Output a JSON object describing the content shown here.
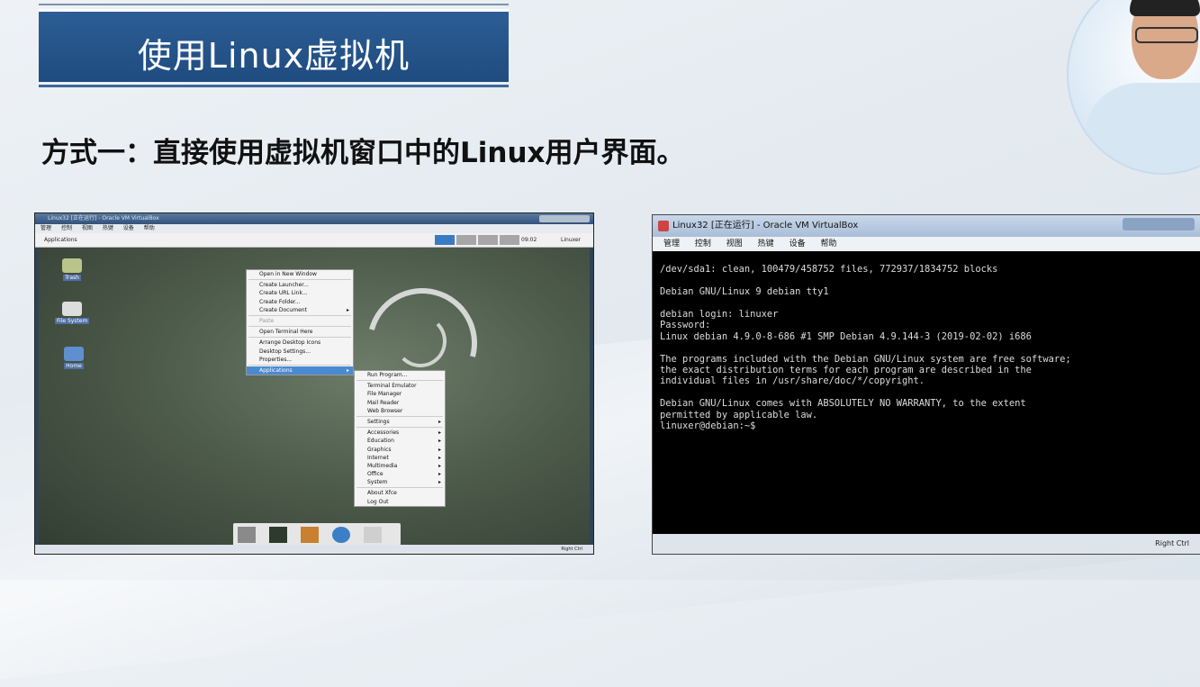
{
  "slide": {
    "title": "使用Linux虚拟机",
    "subtitle": "方式一：直接使用虚拟机窗口中的Linux用户界面。"
  },
  "left_window": {
    "title": "Linux32 [正在运行] - Oracle VM VirtualBox",
    "menu": [
      "管理",
      "控制",
      "视图",
      "热键",
      "设备",
      "帮助"
    ],
    "panel": {
      "applications": "Applications",
      "clock": "09:02",
      "user": "Linuxer"
    },
    "desktop_icons": [
      "Trash",
      "File System",
      "Home"
    ],
    "context_menu": [
      {
        "label": "Open in New Window",
        "arrow": ""
      },
      {
        "label": "Create Launcher...",
        "arrow": ""
      },
      {
        "label": "Create URL Link...",
        "arrow": ""
      },
      {
        "label": "Create Folder...",
        "arrow": ""
      },
      {
        "label": "Create Document",
        "arrow": "▸"
      },
      {
        "label": "Paste",
        "arrow": ""
      },
      {
        "label": "Open Terminal Here",
        "arrow": ""
      },
      {
        "label": "Arrange Desktop Icons",
        "arrow": ""
      },
      {
        "label": "Desktop Settings...",
        "arrow": ""
      },
      {
        "label": "Properties...",
        "arrow": ""
      },
      {
        "label": "Applications",
        "arrow": "▸"
      }
    ],
    "apps_menu": [
      {
        "label": "Run Program...",
        "arrow": ""
      },
      {
        "label": "Terminal Emulator",
        "arrow": ""
      },
      {
        "label": "File Manager",
        "arrow": ""
      },
      {
        "label": "Mail Reader",
        "arrow": ""
      },
      {
        "label": "Web Browser",
        "arrow": ""
      },
      {
        "label": "Settings",
        "arrow": "▸"
      },
      {
        "label": "Accessories",
        "arrow": "▸"
      },
      {
        "label": "Education",
        "arrow": "▸"
      },
      {
        "label": "Graphics",
        "arrow": "▸"
      },
      {
        "label": "Internet",
        "arrow": "▸"
      },
      {
        "label": "Multimedia",
        "arrow": "▸"
      },
      {
        "label": "Office",
        "arrow": "▸"
      },
      {
        "label": "System",
        "arrow": "▸"
      },
      {
        "label": "About Xfce",
        "arrow": ""
      },
      {
        "label": "Log Out",
        "arrow": ""
      }
    ],
    "status": "Right Ctrl"
  },
  "right_window": {
    "title": "Linux32 [正在运行] - Oracle VM VirtualBox",
    "menu": [
      "管理",
      "控制",
      "视图",
      "热键",
      "设备",
      "帮助"
    ],
    "terminal_lines": [
      "/dev/sda1: clean, 100479/458752 files, 772937/1834752 blocks",
      "",
      "Debian GNU/Linux 9 debian tty1",
      "",
      "debian login: linuxer",
      "Password:",
      "Linux debian 4.9.0-8-686 #1 SMP Debian 4.9.144-3 (2019-02-02) i686",
      "",
      "The programs included with the Debian GNU/Linux system are free software;",
      "the exact distribution terms for each program are described in the",
      "individual files in /usr/share/doc/*/copyright.",
      "",
      "Debian GNU/Linux comes with ABSOLUTELY NO WARRANTY, to the extent",
      "permitted by applicable law.",
      "linuxer@debian:~$"
    ],
    "status": "Right Ctrl"
  }
}
